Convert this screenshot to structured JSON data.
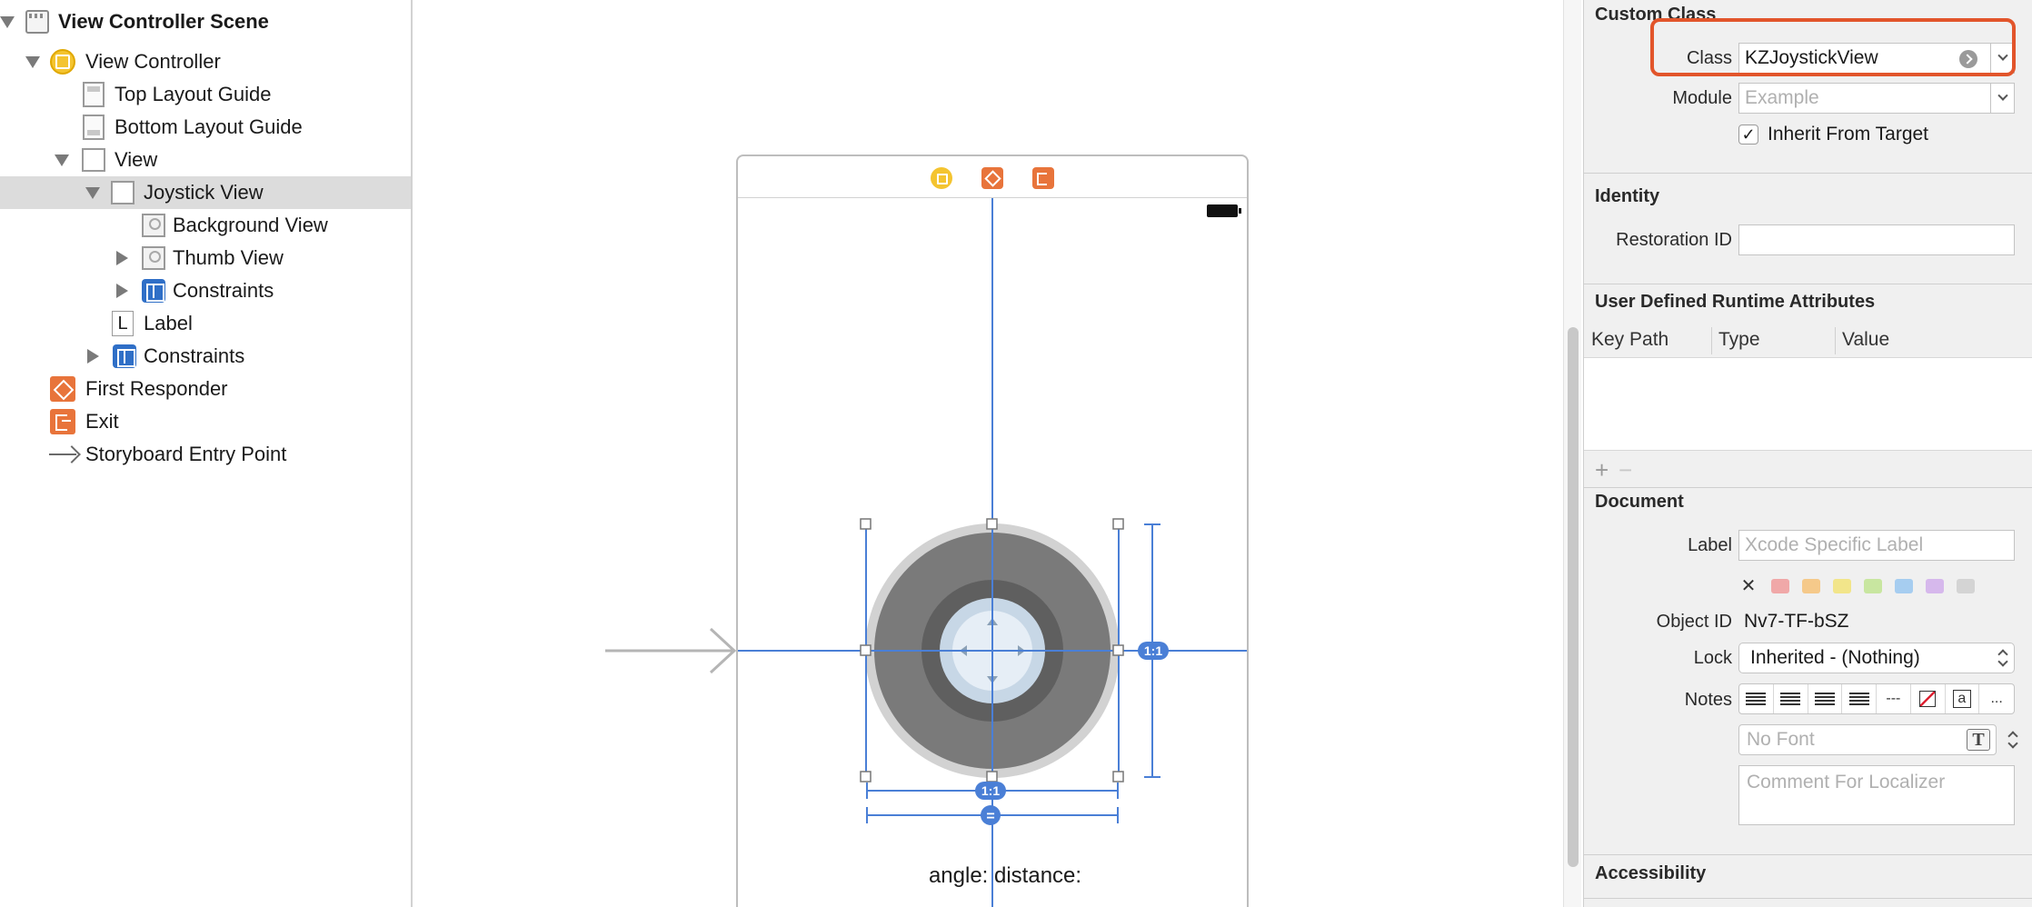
{
  "outline": {
    "items": [
      {
        "label": "View Controller Scene"
      },
      {
        "label": "View Controller"
      },
      {
        "label": "Top Layout Guide"
      },
      {
        "label": "Bottom Layout Guide"
      },
      {
        "label": "View"
      },
      {
        "label": "Joystick View"
      },
      {
        "label": "Background View"
      },
      {
        "label": "Thumb View"
      },
      {
        "label": "Constraints"
      },
      {
        "label": "Label"
      },
      {
        "label": "Constraints"
      },
      {
        "label": "First Responder"
      },
      {
        "label": "Exit"
      },
      {
        "label": "Storyboard Entry Point"
      }
    ]
  },
  "canvas": {
    "angle_label": "angle: distance:",
    "ratio_badge_right": "1:1",
    "ratio_badge_bottom": "1:1",
    "equal_badge": "="
  },
  "inspector": {
    "custom_class": {
      "title": "Custom Class",
      "class_label": "Class",
      "class_value": "KZJoystickView",
      "module_label": "Module",
      "module_placeholder": "Example",
      "inherit_label": "Inherit From Target",
      "inherit_checked": "✓"
    },
    "identity": {
      "title": "Identity",
      "restoration_label": "Restoration ID",
      "restoration_value": ""
    },
    "runtime_attrs": {
      "title": "User Defined Runtime Attributes",
      "columns": [
        "Key Path",
        "Type",
        "Value"
      ],
      "add": "+",
      "remove": "−"
    },
    "document": {
      "title": "Document",
      "label_label": "Label",
      "label_placeholder": "Xcode Specific Label",
      "clear_color": "✕",
      "swatch_colors": [
        "#f0a8a8",
        "#f5c98a",
        "#f2e58a",
        "#c8e6a0",
        "#a6cdf0",
        "#d6b8ec",
        "#d4d4d4"
      ],
      "object_id_label": "Object ID",
      "object_id_value": "Nv7-TF-bSZ",
      "lock_label": "Lock",
      "lock_value": "Inherited - (Nothing)",
      "notes_label": "Notes",
      "font_placeholder": "No Font",
      "font_button": "T",
      "comment_placeholder": "Comment For Localizer",
      "notes_dashes": "---",
      "notes_a": "a",
      "notes_more": "..."
    },
    "accessibility": {
      "title": "Accessibility"
    }
  },
  "colors": {
    "accent": "#2f6fc7",
    "highlight": "#e2552b",
    "constraint_blue": "#4a7fd6"
  }
}
